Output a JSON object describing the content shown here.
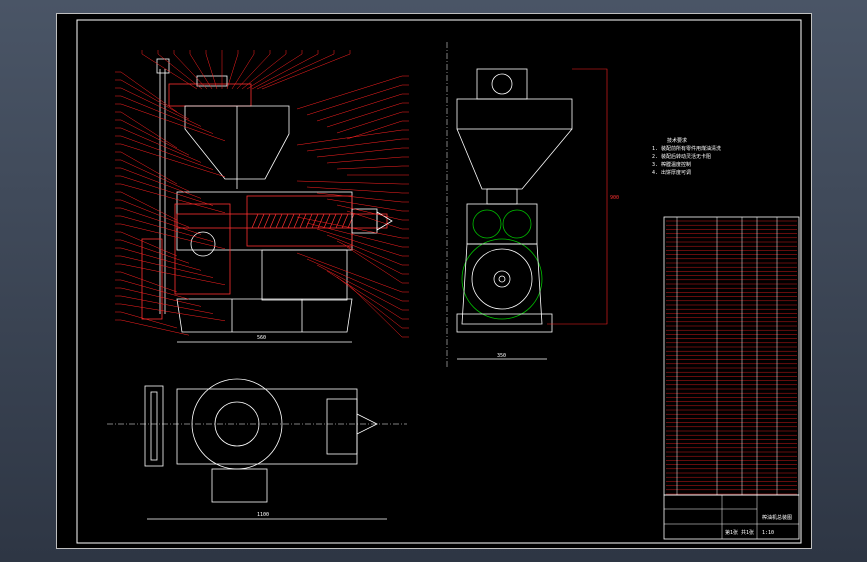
{
  "colors": {
    "background": "#000000",
    "viewport": "#3a4454",
    "outline": "#ffffff",
    "leader": "#ff2020",
    "accent_green": "#00c000",
    "dimension": "#ffffff"
  },
  "drawing": {
    "views": [
      "front-section-view",
      "side-view",
      "top-view"
    ],
    "notes_block": [
      "技术要求",
      "1. 装配前所有零件用煤油清洗",
      "2. 装配后转动灵活无卡阻",
      "3. 榨膛温度控制",
      "4. 出饼厚度可调"
    ],
    "title_block": {
      "name": "榨油机总装图",
      "scale": "1:10",
      "sheet": "第1张 共1张"
    }
  }
}
